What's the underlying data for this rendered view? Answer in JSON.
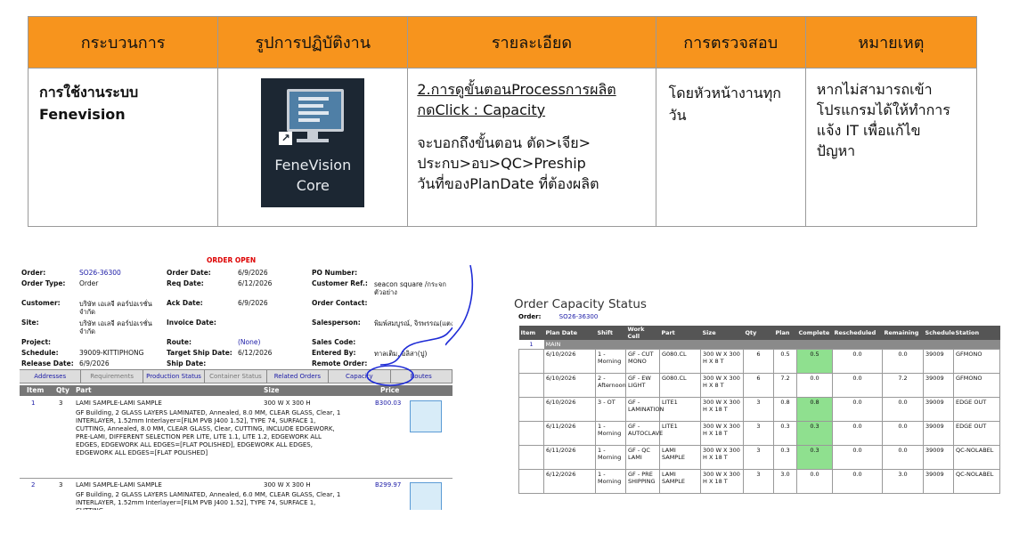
{
  "header": {
    "col1": "กระบวนการ",
    "col2": "รูปการปฏิบัติงาน",
    "col3": "รายละเอียด",
    "col4": "การตรวจสอบ",
    "col5": "หมายเหตุ"
  },
  "row": {
    "process_line1": "การใช้งานระบบ",
    "process_line2": "Fenevision",
    "icon_label_line1": "FeneVision",
    "icon_label_line2": "Core",
    "detail_line1": "2.การดูขั้นตอนProcessการผลิต",
    "detail_line2": "กดClick : Capacity",
    "detail_line3": "จะบอกถึงขั้นตอน ตัด>เจีย>",
    "detail_line4": "ประกบ>อบ>QC>Preship",
    "detail_line5": "วันที่ของPlanDate ที่ต้องผลิต",
    "check": "โดยหัวหน้างานทุกวัน",
    "note_line1": "หากไม่สามารถเข้า",
    "note_line2": "โปรแกรมได้ให้ทำการ",
    "note_line3": "แจ้ง IT  เพื่อแก้ไข",
    "note_line4": "ปัญหา"
  },
  "order": {
    "status": "ORDER OPEN",
    "order_label": "Order:",
    "order_value": "SO26-36300",
    "order_date_label": "Order Date:",
    "order_date": "6/9/2026",
    "po_label": "PO Number:",
    "type_label": "Order Type:",
    "type_value": "Order",
    "req_label": "Req Date:",
    "req_value": "6/12/2026",
    "custref_label": "Customer Ref.:",
    "custref_value1": "seacon square /กระจก",
    "custref_value2": "ตัวอย่าง",
    "customer_label": "Customer:",
    "customer_value1": "บริษัท เอเลจี คอร์ปอเรชั่น",
    "customer_value2": "จำกัด",
    "ack_label": "Ack Date:",
    "ack_value": "6/9/2026",
    "contact_label": "Order Contact:",
    "site_label": "Site:",
    "site_value1": "บริษัท เอเลจี คอร์ปอเรชั่น",
    "site_value2": "จำกัด",
    "invoice_label": "Invoice Date:",
    "sales_label": "Salesperson:",
    "sales_value": "พิมพ์สมบูรณ์, จิรพรรณ(แตง)",
    "project_label": "Project:",
    "route_label": "Route:",
    "route_value": "(None)",
    "salescode_label": "Sales Code:",
    "schedule_label": "Schedule:",
    "schedule_value": "39009-KITTIPHONG",
    "target_label": "Target Ship Date:",
    "target_value": "6/12/2026",
    "entered_label": "Entered By:",
    "entered_value": "ทาลเติม, อลิสา(ปู)",
    "release_label": "Release Date:",
    "release_value": "6/9/2026",
    "ship_label": "Ship Date:",
    "remote_label": "Remote Order:",
    "tabs": [
      "Addresses",
      "Requirements",
      "Production Status",
      "Container Status",
      "Related Orders",
      "Capacity",
      "Routes"
    ],
    "col_item": "Item",
    "col_qty": "Qty",
    "col_part": "Part",
    "col_size": "Size",
    "col_price": "Price",
    "items": [
      {
        "num": "1",
        "qty": "3",
        "part": "LAMI SAMPLE-LAMI SAMPLE",
        "size": "300 W X 300 H",
        "price": "B300.03",
        "desc": "GF Building, 2 GLASS LAYERS LAMINATED, Annealed, 8.0 MM, CLEAR GLASS, Clear, 1 INTERLAYER, 1.52mm Interlayer=[FILM PVB J400 1.52], TYPE 74, SURFACE 1, CUTTING, Annealed, 8.0 MM, CLEAR GLASS, Clear, CUTTING, INCLUDE EDGEWORK, PRE-LAMI, DIFFERENT SELECTION PER LITE, LITE 1.1, LITE 1.2, EDGEWORK ALL EDGES, EDGEWORK ALL EDGES=[FLAT POLISHED], EDGEWORK ALL EDGES, EDGEWORK ALL EDGES=[FLAT POLISHED]"
      },
      {
        "num": "2",
        "qty": "3",
        "part": "LAMI SAMPLE-LAMI SAMPLE",
        "size": "300 W X 300 H",
        "price": "B299.97",
        "desc": "GF Building, 2 GLASS LAYERS LAMINATED, Annealed, 6.0 MM, CLEAR GLASS, Clear, 1 INTERLAYER, 1.52mm Interlayer=[FILM PVB J400 1.52], TYPE 74, SURFACE 1, CUTTING,"
      }
    ]
  },
  "capacity": {
    "title": "Order Capacity Status",
    "order_label": "Order:",
    "order_value": "SO26-36300",
    "columns": [
      "Item",
      "Plan Date",
      "Shift",
      "Work Cell",
      "Part",
      "Size",
      "Qty",
      "Plan",
      "Complete",
      "Rescheduled",
      "Remaining",
      "Schedule",
      "Station"
    ],
    "item_num": "1",
    "group_label": "MAIN",
    "rows": [
      {
        "date": "6/10/2026",
        "shift": "1 - Morning",
        "cell": "GF - CUT MONO",
        "part": "G080.CL",
        "size": "300 W X 300 H X 8 T",
        "qty": "6",
        "plan": "0.5",
        "complete": "0.5",
        "green": true,
        "resched": "0.0",
        "remaining": "0.0",
        "schedule": "39009",
        "station": "GFMONO"
      },
      {
        "date": "6/10/2026",
        "shift": "2 - Afternoon",
        "cell": "GF - EW LIGHT",
        "part": "G080.CL",
        "size": "300 W X 300 H X 8 T",
        "qty": "6",
        "plan": "7.2",
        "complete": "0.0",
        "green": false,
        "resched": "0.0",
        "remaining": "7.2",
        "schedule": "39009",
        "station": "GFMONO"
      },
      {
        "date": "6/10/2026",
        "shift": "3 - OT",
        "cell": "GF - LAMINATION",
        "part": "LITE1",
        "size": "300 W X 300 H X 18 T",
        "qty": "3",
        "plan": "0.8",
        "complete": "0.8",
        "green": true,
        "resched": "0.0",
        "remaining": "0.0",
        "schedule": "39009",
        "station": "EDGE OUT"
      },
      {
        "date": "6/11/2026",
        "shift": "1 - Morning",
        "cell": "GF - AUTOCLAVE",
        "part": "LITE1",
        "size": "300 W X 300 H X 18 T",
        "qty": "3",
        "plan": "0.3",
        "complete": "0.3",
        "green": true,
        "resched": "0.0",
        "remaining": "0.0",
        "schedule": "39009",
        "station": "EDGE OUT"
      },
      {
        "date": "6/11/2026",
        "shift": "1 - Morning",
        "cell": "GF - QC LAMI",
        "part": "LAMI SAMPLE",
        "size": "300 W X 300 H X 18 T",
        "qty": "3",
        "plan": "0.3",
        "complete": "0.3",
        "green": true,
        "resched": "0.0",
        "remaining": "0.0",
        "schedule": "39009",
        "station": "QC-NOLABEL"
      },
      {
        "date": "6/12/2026",
        "shift": "1 - Morning",
        "cell": "GF - PRE SHIPPING",
        "part": "LAMI SAMPLE",
        "size": "300 W X 300 H X 18 T",
        "qty": "3",
        "plan": "3.0",
        "complete": "0.0",
        "green": false,
        "resched": "0.0",
        "remaining": "3.0",
        "schedule": "39009",
        "station": "QC-NOLABEL"
      }
    ]
  },
  "colors": {
    "header_orange": "#f7941d",
    "complete_green": "#8fe08f",
    "annotation_blue": "#1e2bd6"
  }
}
